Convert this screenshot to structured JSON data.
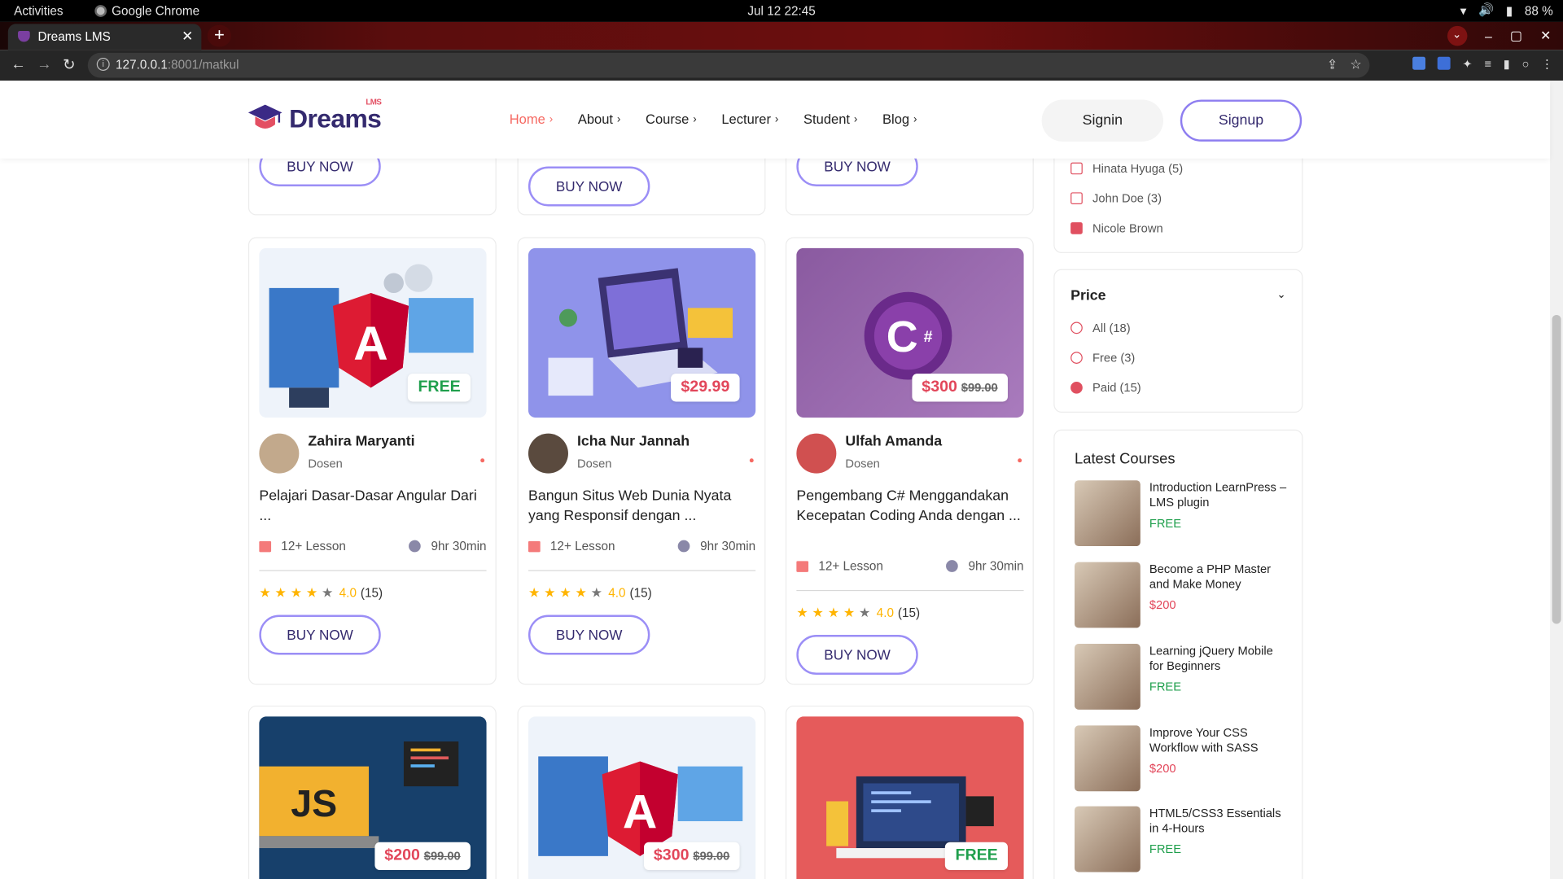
{
  "os": {
    "activities": "Activities",
    "app_name": "Google Chrome",
    "clock": "Jul 12  22:45",
    "battery": "88 %"
  },
  "browser": {
    "tab_title": "Dreams LMS",
    "url_host": "127.0.0.1",
    "url_rest": ":8001/matkul"
  },
  "header": {
    "logo_text": "Dreams",
    "logo_badge": "LMS",
    "nav": [
      {
        "label": "Home",
        "active": true
      },
      {
        "label": "About"
      },
      {
        "label": "Course"
      },
      {
        "label": "Lecturer"
      },
      {
        "label": "Student"
      },
      {
        "label": "Blog"
      }
    ],
    "signin": "Signin",
    "signup": "Signup"
  },
  "buy_label": "BUY NOW",
  "cards": [
    {
      "price": "FREE",
      "price_type": "free",
      "lecturer": "Zahira Maryanti",
      "role": "Dosen",
      "title": "Pelajari Dasar-Dasar Angular Dari ...",
      "lessons": "12+ Lesson",
      "duration": "9hr 30min",
      "rating": "4.0",
      "reviews": "(15)",
      "stars": 4
    },
    {
      "price": "$29.99",
      "price_type": "paid",
      "lecturer": "Icha Nur Jannah",
      "role": "Dosen",
      "title": "Bangun Situs Web Dunia Nyata yang Responsif dengan ...",
      "lessons": "12+ Lesson",
      "duration": "9hr 30min",
      "rating": "4.0",
      "reviews": "(15)",
      "stars": 4
    },
    {
      "price": "$300",
      "old_price": "$99.00",
      "price_type": "paid",
      "lecturer": "Ulfah Amanda",
      "role": "Dosen",
      "title": "Pengembang C# Menggandakan Kecepatan Coding Anda dengan ...",
      "lessons": "12+ Lesson",
      "duration": "9hr 30min",
      "rating": "4.0",
      "reviews": "(15)",
      "stars": 4
    }
  ],
  "bottom_cards": [
    {
      "price": "$200",
      "old_price": "$99.00"
    },
    {
      "price": "$300",
      "old_price": "$99.00"
    },
    {
      "price": "FREE"
    }
  ],
  "sidebar": {
    "instructors": [
      {
        "label": "Hinata Hyuga (5)",
        "checked": false
      },
      {
        "label": "John Doe (3)",
        "checked": false
      },
      {
        "label": "Nicole Brown",
        "checked": true
      }
    ],
    "price_title": "Price",
    "price_options": [
      {
        "label": "All (18)",
        "checked": false
      },
      {
        "label": "Free (3)",
        "checked": false
      },
      {
        "label": "Paid (15)",
        "checked": true
      }
    ],
    "latest_title": "Latest Courses",
    "latest": [
      {
        "title": "Introduction LearnPress – LMS plugin",
        "price": "FREE",
        "type": "free"
      },
      {
        "title": "Become a PHP Master and Make Money",
        "price": "$200",
        "type": "paid"
      },
      {
        "title": "Learning jQuery Mobile for Beginners",
        "price": "FREE",
        "type": "free"
      },
      {
        "title": "Improve Your CSS Workflow with SASS",
        "price": "$200",
        "type": "paid"
      },
      {
        "title": "HTML5/CSS3 Essentials in 4-Hours",
        "price": "FREE",
        "type": "free"
      }
    ]
  }
}
